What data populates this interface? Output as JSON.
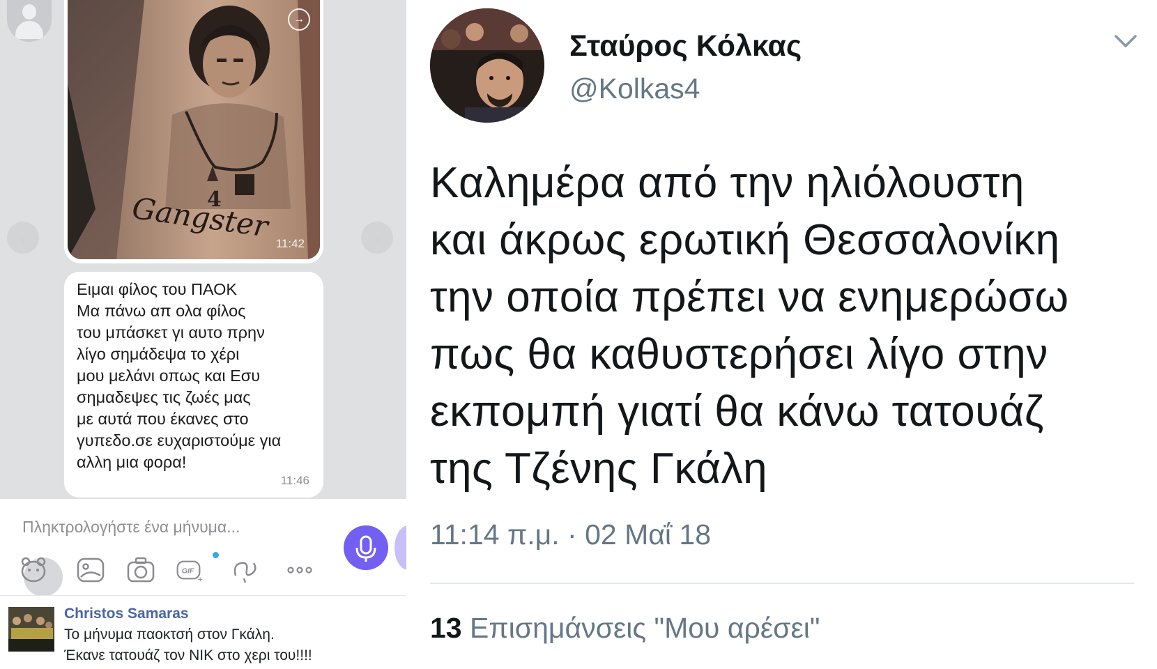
{
  "chat": {
    "photo_time": "11:42",
    "message_lines": [
      "Ειμαι φίλος του ΠΑΟΚ",
      "Μα πάνω απ ολα φίλος",
      "του μπάσκετ γι αυτο πρην",
      "λίγο σημάδεψα το χέρι",
      "μου μελάνι οπως και Εσυ",
      "σημαδεψες τις ζωές μας",
      "με αυτά που έκανες στο",
      "γυπεδο.σε ευχαριστούμε για",
      "αλλη μια φορα!"
    ],
    "message_time": "11:46",
    "composer_placeholder": "Πληκτρολογήστε ένα μήνυμα...",
    "toolbar_icons": [
      "sticker-icon",
      "gallery-icon",
      "camera-icon",
      "gif-icon",
      "doodle-icon",
      "more-icon",
      "microphone-icon"
    ]
  },
  "facebook_post": {
    "author": "Christos Samaras",
    "line1": "Το μήνυμα παοκτσή στον Γκάλη.",
    "line2": "Έκανε τατουάζ τον ΝΙΚ στο χερι του!!!!"
  },
  "tweet": {
    "display_name": "Σταύρος Κόλκας",
    "handle": "@Kolkas4",
    "text_lines": [
      "Καλημέρα από την ηλιόλουστη",
      "και άκρως ερωτική Θεσσαλονίκη",
      "την οποία πρέπει να ενημερώσω",
      "πως θα καθυστερήσει λίγο στην",
      "εκπομπή γιατί θα κάνω τατουάζ",
      "της Τζένης Γκάλη"
    ],
    "timestamp": "11:14 π.μ. · 02 Μαΐ 18",
    "likes_count": "13",
    "likes_label": "Επισημάνσεις \"Μου αρέσει\""
  }
}
